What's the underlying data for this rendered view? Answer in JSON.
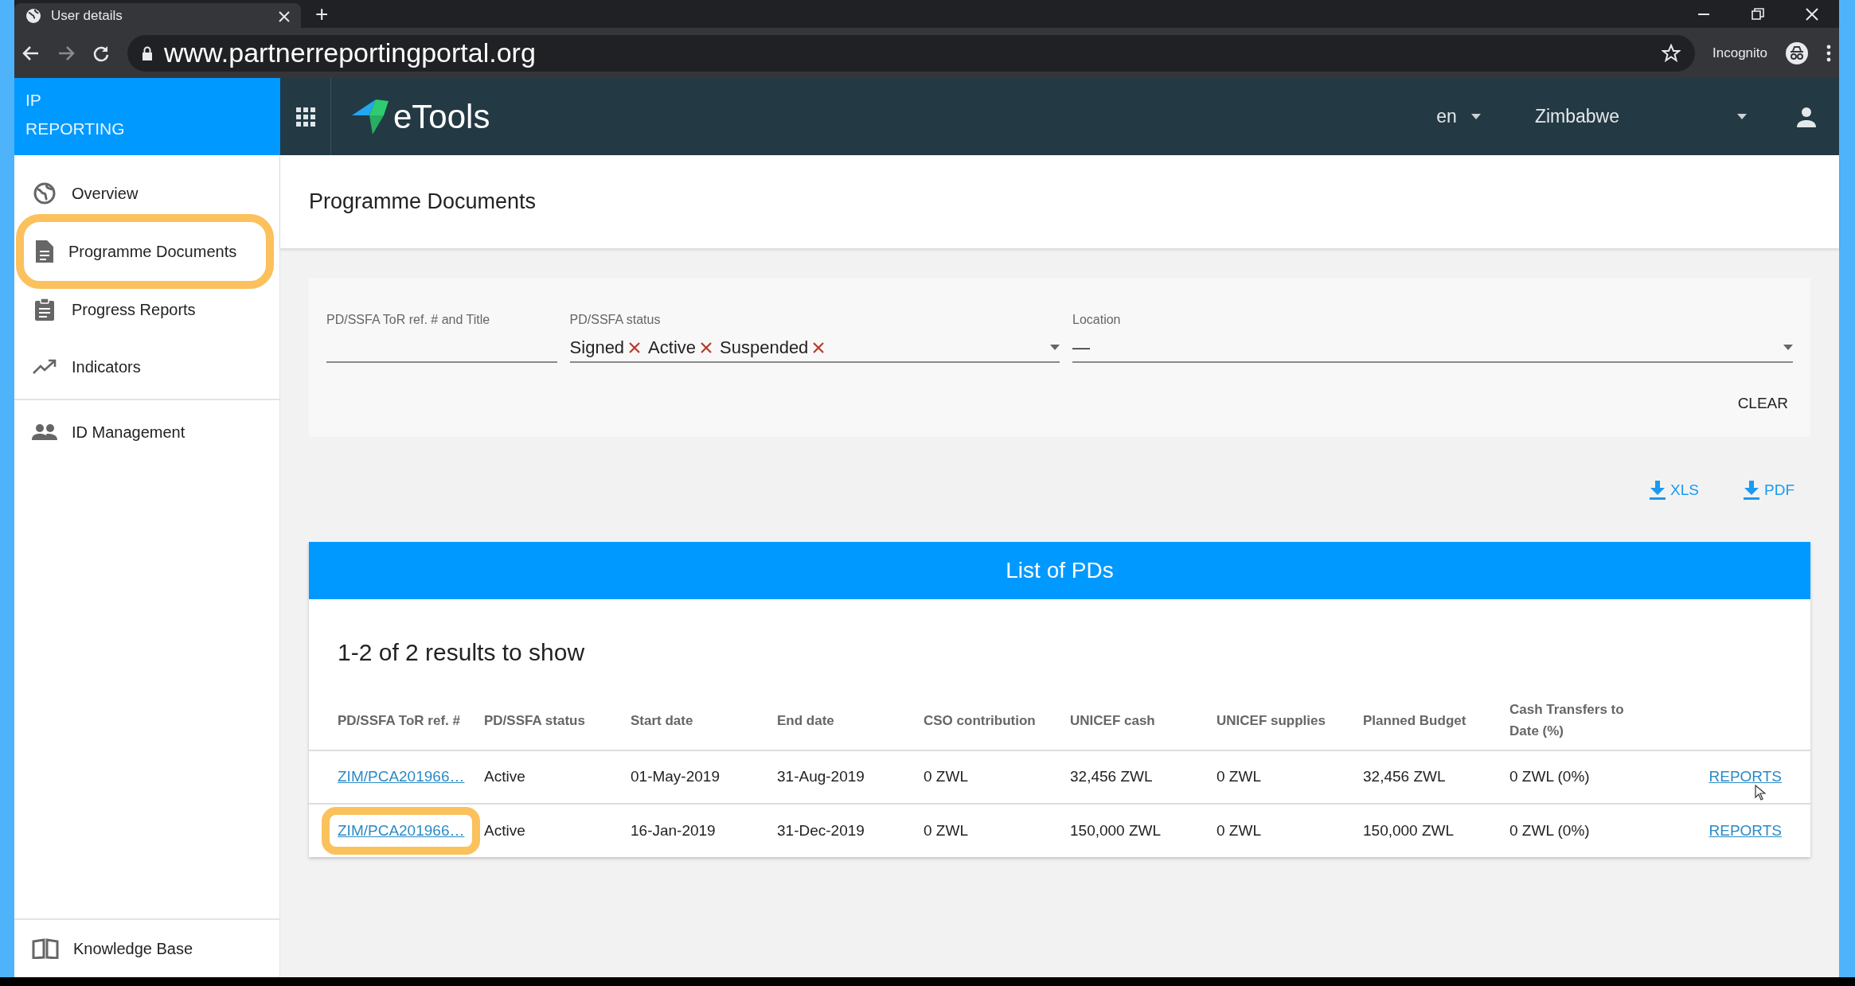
{
  "browser": {
    "tab_title": "User details",
    "new_tab": "+",
    "url": "www.partnerreportingportal.org",
    "profile": "Incognito"
  },
  "app": {
    "brand_lines": [
      "IP",
      "REPORTING"
    ],
    "logo_text": "eTools",
    "language": "en",
    "country": "Zimbabwe"
  },
  "sidebar": {
    "items": [
      {
        "label": "Overview",
        "highlighted": false
      },
      {
        "label": "Programme Documents",
        "highlighted": true
      },
      {
        "label": "Progress Reports",
        "highlighted": false
      },
      {
        "label": "Indicators",
        "highlighted": false
      },
      {
        "label": "ID Management",
        "highlighted": false
      }
    ],
    "footer": {
      "label": "Knowledge Base"
    }
  },
  "page": {
    "title": "Programme Documents"
  },
  "filters": [
    {
      "kind": "text",
      "label": "PD/SSFA ToR ref. # and Title"
    },
    {
      "kind": "chips",
      "label": "PD/SSFA status",
      "chips": [
        "Signed",
        "Active",
        "Suspended"
      ]
    },
    {
      "kind": "select",
      "label": "Location",
      "value": "—"
    }
  ],
  "clear_button": "CLEAR",
  "exports": [
    "XLS",
    "PDF"
  ],
  "table": {
    "title": "List of PDs",
    "summary": "1-2 of 2 results to show",
    "columns": [
      "PD/SSFA ToR ref. #",
      "PD/SSFA status",
      "Start date",
      "End date",
      "CSO contribution",
      "UNICEF cash",
      "UNICEF supplies",
      "Planned Budget",
      "Cash Transfers to Date (%)"
    ],
    "rows": [
      {
        "highlighted": false,
        "cells": [
          "ZIM/PCA201966…",
          "Active",
          "01-May-2019",
          "31-Aug-2019",
          "0 ZWL",
          "32,456 ZWL",
          "0 ZWL",
          "32,456 ZWL",
          "0 ZWL (0%)"
        ],
        "action": "REPORTS"
      },
      {
        "highlighted": true,
        "cells": [
          "ZIM/PCA201966…",
          "Active",
          "16-Jan-2019",
          "31-Dec-2019",
          "0 ZWL",
          "150,000 ZWL",
          "0 ZWL",
          "150,000 ZWL",
          "0 ZWL (0%)"
        ],
        "action": "REPORTS"
      }
    ]
  }
}
